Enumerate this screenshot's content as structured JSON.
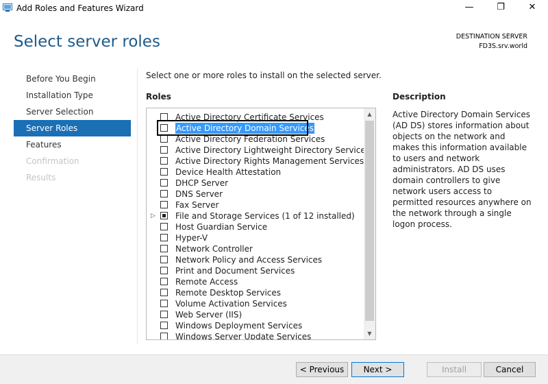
{
  "window": {
    "title": "Add Roles and Features Wizard",
    "minimize": "—",
    "maximize": "❐",
    "close": "✕"
  },
  "header": {
    "page_title": "Select server roles",
    "destination_label": "DESTINATION SERVER",
    "destination_server": "FD3S.srv.world"
  },
  "nav": {
    "items": [
      {
        "label": "Before You Begin",
        "state": "normal"
      },
      {
        "label": "Installation Type",
        "state": "normal"
      },
      {
        "label": "Server Selection",
        "state": "normal"
      },
      {
        "label": "Server Roles",
        "state": "active"
      },
      {
        "label": "Features",
        "state": "normal"
      },
      {
        "label": "Confirmation",
        "state": "disabled"
      },
      {
        "label": "Results",
        "state": "disabled"
      }
    ]
  },
  "main": {
    "instruction": "Select one or more roles to install on the selected server.",
    "roles_label": "Roles",
    "roles": [
      {
        "label": "Active Directory Certificate Services",
        "checked": false
      },
      {
        "label": "Active Directory Domain Services",
        "checked": false,
        "selected": true
      },
      {
        "label": "Active Directory Federation Services",
        "checked": false
      },
      {
        "label": "Active Directory Lightweight Directory Services",
        "checked": false
      },
      {
        "label": "Active Directory Rights Management Services",
        "checked": false
      },
      {
        "label": "Device Health Attestation",
        "checked": false
      },
      {
        "label": "DHCP Server",
        "checked": false
      },
      {
        "label": "DNS Server",
        "checked": false
      },
      {
        "label": "Fax Server",
        "checked": false
      },
      {
        "label": "File and Storage Services (1 of 12 installed)",
        "checked": "partial",
        "expandable": true
      },
      {
        "label": "Host Guardian Service",
        "checked": false
      },
      {
        "label": "Hyper-V",
        "checked": false
      },
      {
        "label": "Network Controller",
        "checked": false
      },
      {
        "label": "Network Policy and Access Services",
        "checked": false
      },
      {
        "label": "Print and Document Services",
        "checked": false
      },
      {
        "label": "Remote Access",
        "checked": false
      },
      {
        "label": "Remote Desktop Services",
        "checked": false
      },
      {
        "label": "Volume Activation Services",
        "checked": false
      },
      {
        "label": "Web Server (IIS)",
        "checked": false
      },
      {
        "label": "Windows Deployment Services",
        "checked": false
      },
      {
        "label": "Windows Server Update Services",
        "checked": false
      }
    ],
    "description_label": "Description",
    "description_text": "Active Directory Domain Services (AD DS) stores information about objects on the network and makes this information available to users and network administrators. AD DS uses domain controllers to give network users access to permitted resources anywhere on the network through a single logon process."
  },
  "footer": {
    "previous_label": "< Previous",
    "next_label": "Next >",
    "install_label": "Install",
    "cancel_label": "Cancel"
  },
  "icons": {
    "app": "server-manager-icon",
    "scroll_up": "chevron-up-icon",
    "scroll_down": "chevron-down-icon",
    "expander": "triangle-right-icon"
  },
  "colors": {
    "title_blue": "#1d5b8a",
    "nav_active": "#1a6fb5",
    "selection": "#3399ff"
  }
}
